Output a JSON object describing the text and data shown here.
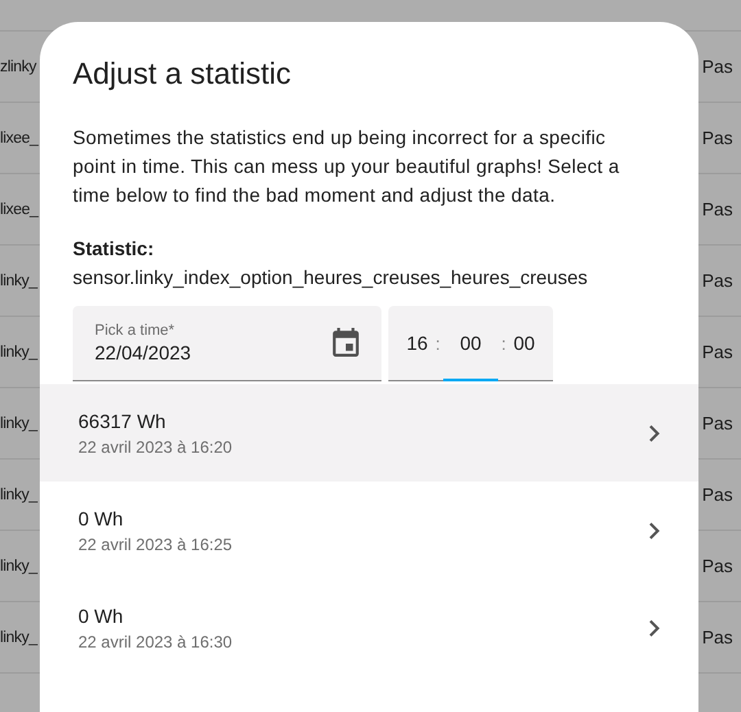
{
  "background_table": {
    "rows": [
      {
        "column_1": "zlinky",
        "column_2": "Pas"
      },
      {
        "column_1": "lixee_",
        "column_2": "Pas"
      },
      {
        "column_1": "lixee_",
        "column_2": "Pas"
      },
      {
        "column_1": "linky_",
        "column_2": "Pas"
      },
      {
        "column_1": "linky_",
        "column_2": "Pas"
      },
      {
        "column_1": "linky_",
        "column_2": "Pas"
      },
      {
        "column_1": "linky_",
        "column_2": "Pas"
      },
      {
        "column_1": "linky_",
        "column_2": "Pas"
      },
      {
        "column_1": "linky_",
        "column_2": "Pas"
      }
    ]
  },
  "dialog": {
    "title": "Adjust a statistic",
    "description": "Sometimes the statistics end up being incorrect for a specific point in time. This can mess up your beautiful graphs! Select a time below to find the bad moment and adjust the data.",
    "statistic_label": "Statistic:",
    "statistic_id": "sensor.linky_index_option_heures_creuses_heures_creuses",
    "date_field": {
      "label": "Pick a time*",
      "value": "22/04/2023"
    },
    "time_field": {
      "parts": [
        {
          "value": "16",
          "selected": false
        },
        {
          "value": "00",
          "selected": true
        },
        {
          "value": "00",
          "selected": false
        }
      ],
      "separator": ":"
    },
    "entries": [
      {
        "value": "66317 Wh",
        "time": "22 avril 2023 à 16:20",
        "selected": true
      },
      {
        "value": "0 Wh",
        "time": "22 avril 2023 à 16:25",
        "selected": false
      },
      {
        "value": "0 Wh",
        "time": "22 avril 2023 à 16:30",
        "selected": false
      }
    ]
  }
}
